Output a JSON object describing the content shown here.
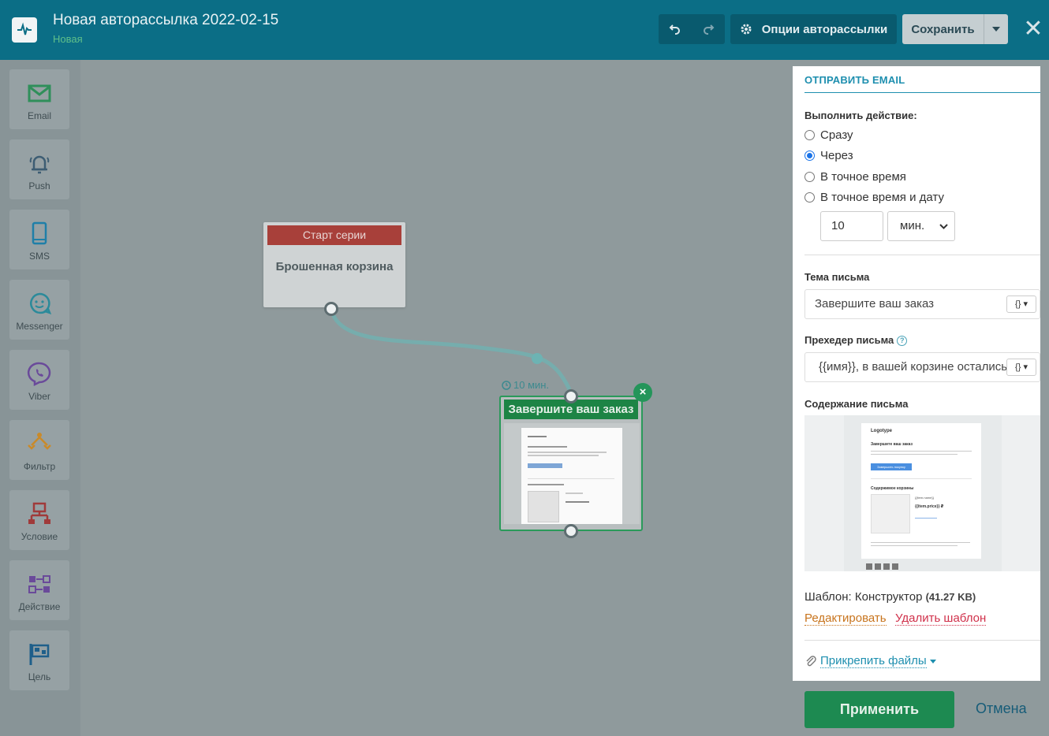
{
  "header": {
    "title": "Новая авторассылка 2022-02-15",
    "status": "Новая",
    "options_label": "Опции авторассылки",
    "save_label": "Сохранить"
  },
  "palette": [
    {
      "label": "Email",
      "icon": "envelope-icon"
    },
    {
      "label": "Push",
      "icon": "bell-icon"
    },
    {
      "label": "SMS",
      "icon": "phone-icon"
    },
    {
      "label": "Messenger",
      "icon": "chat-icon"
    },
    {
      "label": "Viber",
      "icon": "viber-icon"
    },
    {
      "label": "Фильтр",
      "icon": "filter-icon"
    },
    {
      "label": "Условие",
      "icon": "condition-icon"
    },
    {
      "label": "Действие",
      "icon": "action-icon"
    },
    {
      "label": "Цель",
      "icon": "flag-icon"
    }
  ],
  "canvas": {
    "start_node": {
      "header": "Старт серии",
      "body": "Брошенная корзина"
    },
    "delay_label": "10 мин.",
    "email_node": {
      "header": "Завершите ваш заказ"
    }
  },
  "panel": {
    "title": "ОТПРАВИТЬ EMAIL",
    "action_label": "Выполнить действие:",
    "options": [
      "Сразу",
      "Через",
      "В точное время",
      "В точное время и дату"
    ],
    "selected_option": "Через",
    "delay_value": "10",
    "delay_unit": "мин.",
    "subject_label": "Тема письма",
    "subject_value": "Завершите ваш заказ",
    "preheader_label": "Прехедер письма",
    "preheader_value": "{{имя}}, в вашей корзине остались",
    "var_button": "{}",
    "content_label": "Содержание письма",
    "template_label": "Шаблон: Конструктор",
    "template_size": "(41.27 KB)",
    "edit_link": "Редактировать",
    "delete_link": "Удалить шаблон",
    "attach_label": "Прикрепить файлы"
  },
  "preview": {
    "logo": "Logotype",
    "heading": "Завершите ваш заказ",
    "button": "Завершить покупку",
    "section": "Содержимое корзины",
    "item_name": "{{item.name}}",
    "item_price": "{{item.price}} ₽"
  },
  "footer": {
    "apply_label": "Применить",
    "cancel_label": "Отмена"
  },
  "colors": {
    "header": "#0b6e86",
    "start_header": "#a8403a",
    "email_header": "#1d8445",
    "accent": "#1e8faf"
  }
}
